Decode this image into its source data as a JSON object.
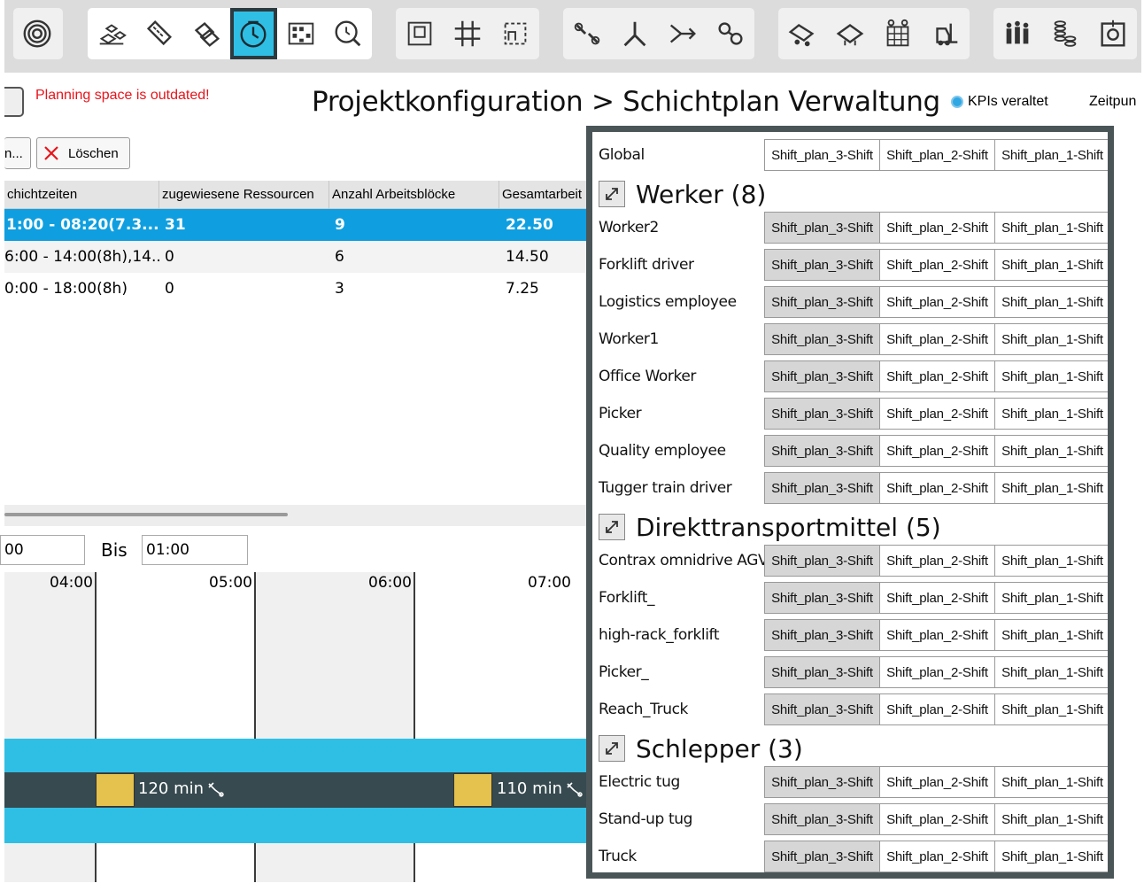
{
  "toolbar": {
    "groups": [
      {
        "items": [
          "radar-icon"
        ]
      },
      {
        "items": [
          "resources-icon",
          "ruler-icon",
          "layers-icon",
          "clock-icon",
          "matrix-icon",
          "analysis-icon"
        ]
      },
      {
        "items": [
          "floorplan-icon",
          "grid-icon",
          "area-icon"
        ]
      },
      {
        "items": [
          "connection-icon",
          "split-icon",
          "merge-icon",
          "link-icon"
        ]
      },
      {
        "items": [
          "truck-icon",
          "carrier-icon",
          "rack-icon",
          "forklift-icon"
        ]
      },
      {
        "items": [
          "people-icon",
          "stack-icon",
          "target-icon"
        ]
      }
    ]
  },
  "header": {
    "outdated_text": "Planning space is outdated!",
    "title": "Projektkonfiguration > Schichtplan Verwaltung",
    "kpi_text": "KPIs veraltet",
    "time_label": "Zeitpun"
  },
  "left": {
    "btn_partial": "n...",
    "btn_delete": "Löschen",
    "table": {
      "headers": [
        "chichtzeiten",
        "zugewiesene Ressourcen",
        "Anzahl Arbeitsblöcke",
        "Gesamtarbeit"
      ],
      "rows": [
        [
          "1:00 - 08:20(7.3...",
          "31",
          "9",
          "22.50"
        ],
        [
          "6:00 - 14:00(8h),14...",
          "0",
          "6",
          "14.50"
        ],
        [
          "0:00 - 18:00(8h)",
          "0",
          "3",
          "7.25"
        ]
      ]
    },
    "from_value": "00",
    "bis_label": "Bis",
    "bis_value": "01:00",
    "timeline": {
      "hours": [
        "04:00",
        "05:00",
        "06:00",
        "07:00"
      ],
      "block1_label": "120 min",
      "block2_label": "110 min"
    }
  },
  "right": {
    "segments": [
      "Shift_plan_3-Shift",
      "Shift_plan_2-Shift",
      "Shift_plan_1-Shift"
    ],
    "global_label": "Global",
    "sections": [
      {
        "title": "Werker (8)",
        "items": [
          "Worker2",
          "Forklift driver",
          "Logistics employee",
          "Worker1",
          "Office Worker",
          "Picker",
          "Quality employee",
          "Tugger train driver"
        ]
      },
      {
        "title": "Direkttransportmittel (5)",
        "items": [
          "Contrax omnidrive AGV",
          "Forklift_",
          "high-rack_forklift",
          "Picker_",
          "Reach_Truck"
        ]
      },
      {
        "title": "Schlepper (3)",
        "items": [
          "Electric tug",
          "Stand-up tug",
          "Truck"
        ]
      }
    ]
  },
  "colors": {
    "accent": "#2fbfe5",
    "selection": "#0f9fe0",
    "panel_border": "#4a5558",
    "warning": "#e8141b",
    "block": "#e5c14d"
  }
}
